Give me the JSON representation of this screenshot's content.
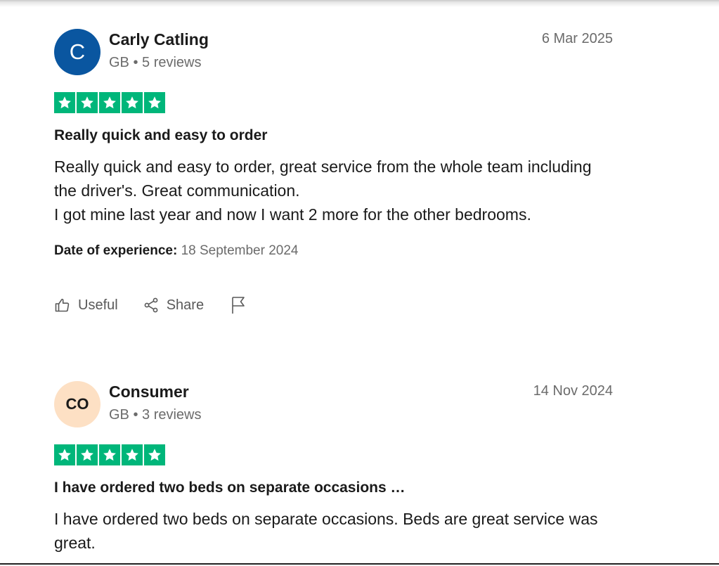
{
  "reviews": [
    {
      "avatar_initials": "C",
      "avatar_color": "#0a56a0",
      "name": "Carly Catling",
      "meta": "GB • 5 reviews",
      "date": "6 Mar 2025",
      "rating": 5,
      "title": "Really quick and easy to order",
      "body": [
        "Really quick and easy to order, great service from the whole team including the driver's. Great communication.",
        "I got mine last year and now I want 2 more for the other bedrooms."
      ],
      "experience_label": "Date of experience:",
      "experience_date": "18 September 2024",
      "actions": {
        "useful": "Useful",
        "share": "Share"
      }
    },
    {
      "avatar_initials": "CO",
      "avatar_color": "#fde0c4",
      "name": "Consumer",
      "meta": "GB • 3 reviews",
      "date": "14 Nov 2024",
      "rating": 5,
      "title": "I have ordered two beds on separate occasions …",
      "body": [
        "I have ordered two beds on separate occasions. Beds are great service was great."
      ]
    }
  ],
  "colors": {
    "star_green": "#00b67a",
    "muted_text": "#6b6b6b",
    "primary_text": "#1a1a1a"
  },
  "icons": [
    "star-icon",
    "thumbs-up-icon",
    "share-icon",
    "flag-icon"
  ]
}
